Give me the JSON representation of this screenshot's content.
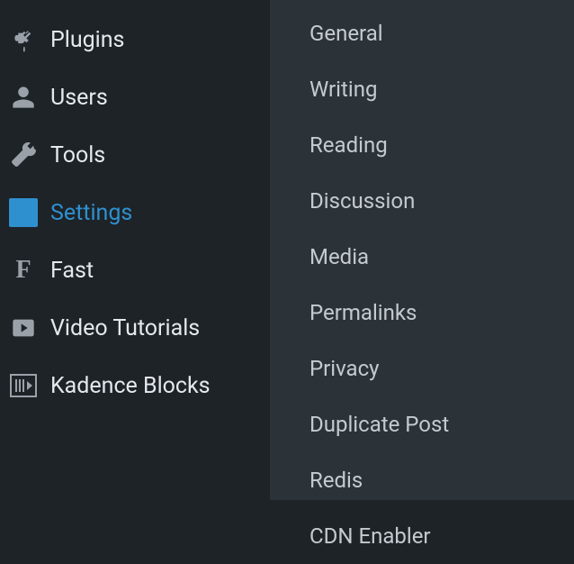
{
  "sidebar": {
    "items": [
      {
        "label": "Plugins"
      },
      {
        "label": "Users"
      },
      {
        "label": "Tools"
      },
      {
        "label": "Settings"
      },
      {
        "label": "Fast"
      },
      {
        "label": "Video Tutorials"
      },
      {
        "label": "Kadence Blocks"
      }
    ]
  },
  "submenu": {
    "items": [
      {
        "label": "General"
      },
      {
        "label": "Writing"
      },
      {
        "label": "Reading"
      },
      {
        "label": "Discussion"
      },
      {
        "label": "Media"
      },
      {
        "label": "Permalinks"
      },
      {
        "label": "Privacy"
      },
      {
        "label": "Duplicate Post"
      },
      {
        "label": "Redis"
      },
      {
        "label": "CDN Enabler"
      }
    ]
  }
}
